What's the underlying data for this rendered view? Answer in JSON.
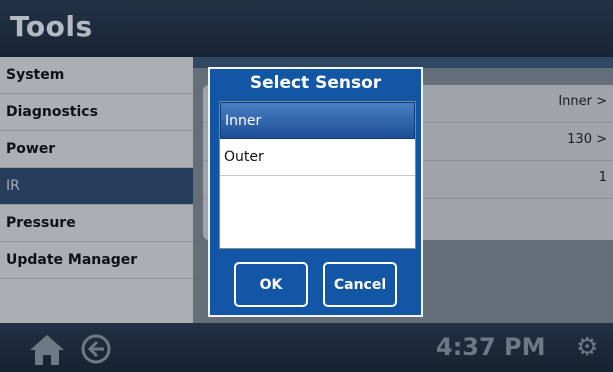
{
  "header": {
    "title": "Tools"
  },
  "sidebar": {
    "items": [
      {
        "label": "System"
      },
      {
        "label": "Diagnostics"
      },
      {
        "label": "Power"
      },
      {
        "label": "IR"
      },
      {
        "label": "Pressure"
      },
      {
        "label": "Update Manager"
      },
      {
        "label": ""
      }
    ]
  },
  "main": {
    "rows": [
      {
        "value": "Inner >"
      },
      {
        "value": "130 >"
      },
      {
        "value": "1"
      }
    ]
  },
  "dialog": {
    "title": "Select Sensor",
    "options": [
      {
        "label": "Inner"
      },
      {
        "label": "Outer"
      }
    ],
    "selected": "Inner",
    "ok_label": "OK",
    "cancel_label": "Cancel"
  },
  "footer": {
    "time": "4:37 PM"
  },
  "colors": {
    "accent": "#1456a6",
    "selected_item": "#2f4a6b",
    "header": "#2d3c50"
  },
  "icons": [
    "home-icon",
    "back-arrow-icon",
    "gear-icon"
  ]
}
